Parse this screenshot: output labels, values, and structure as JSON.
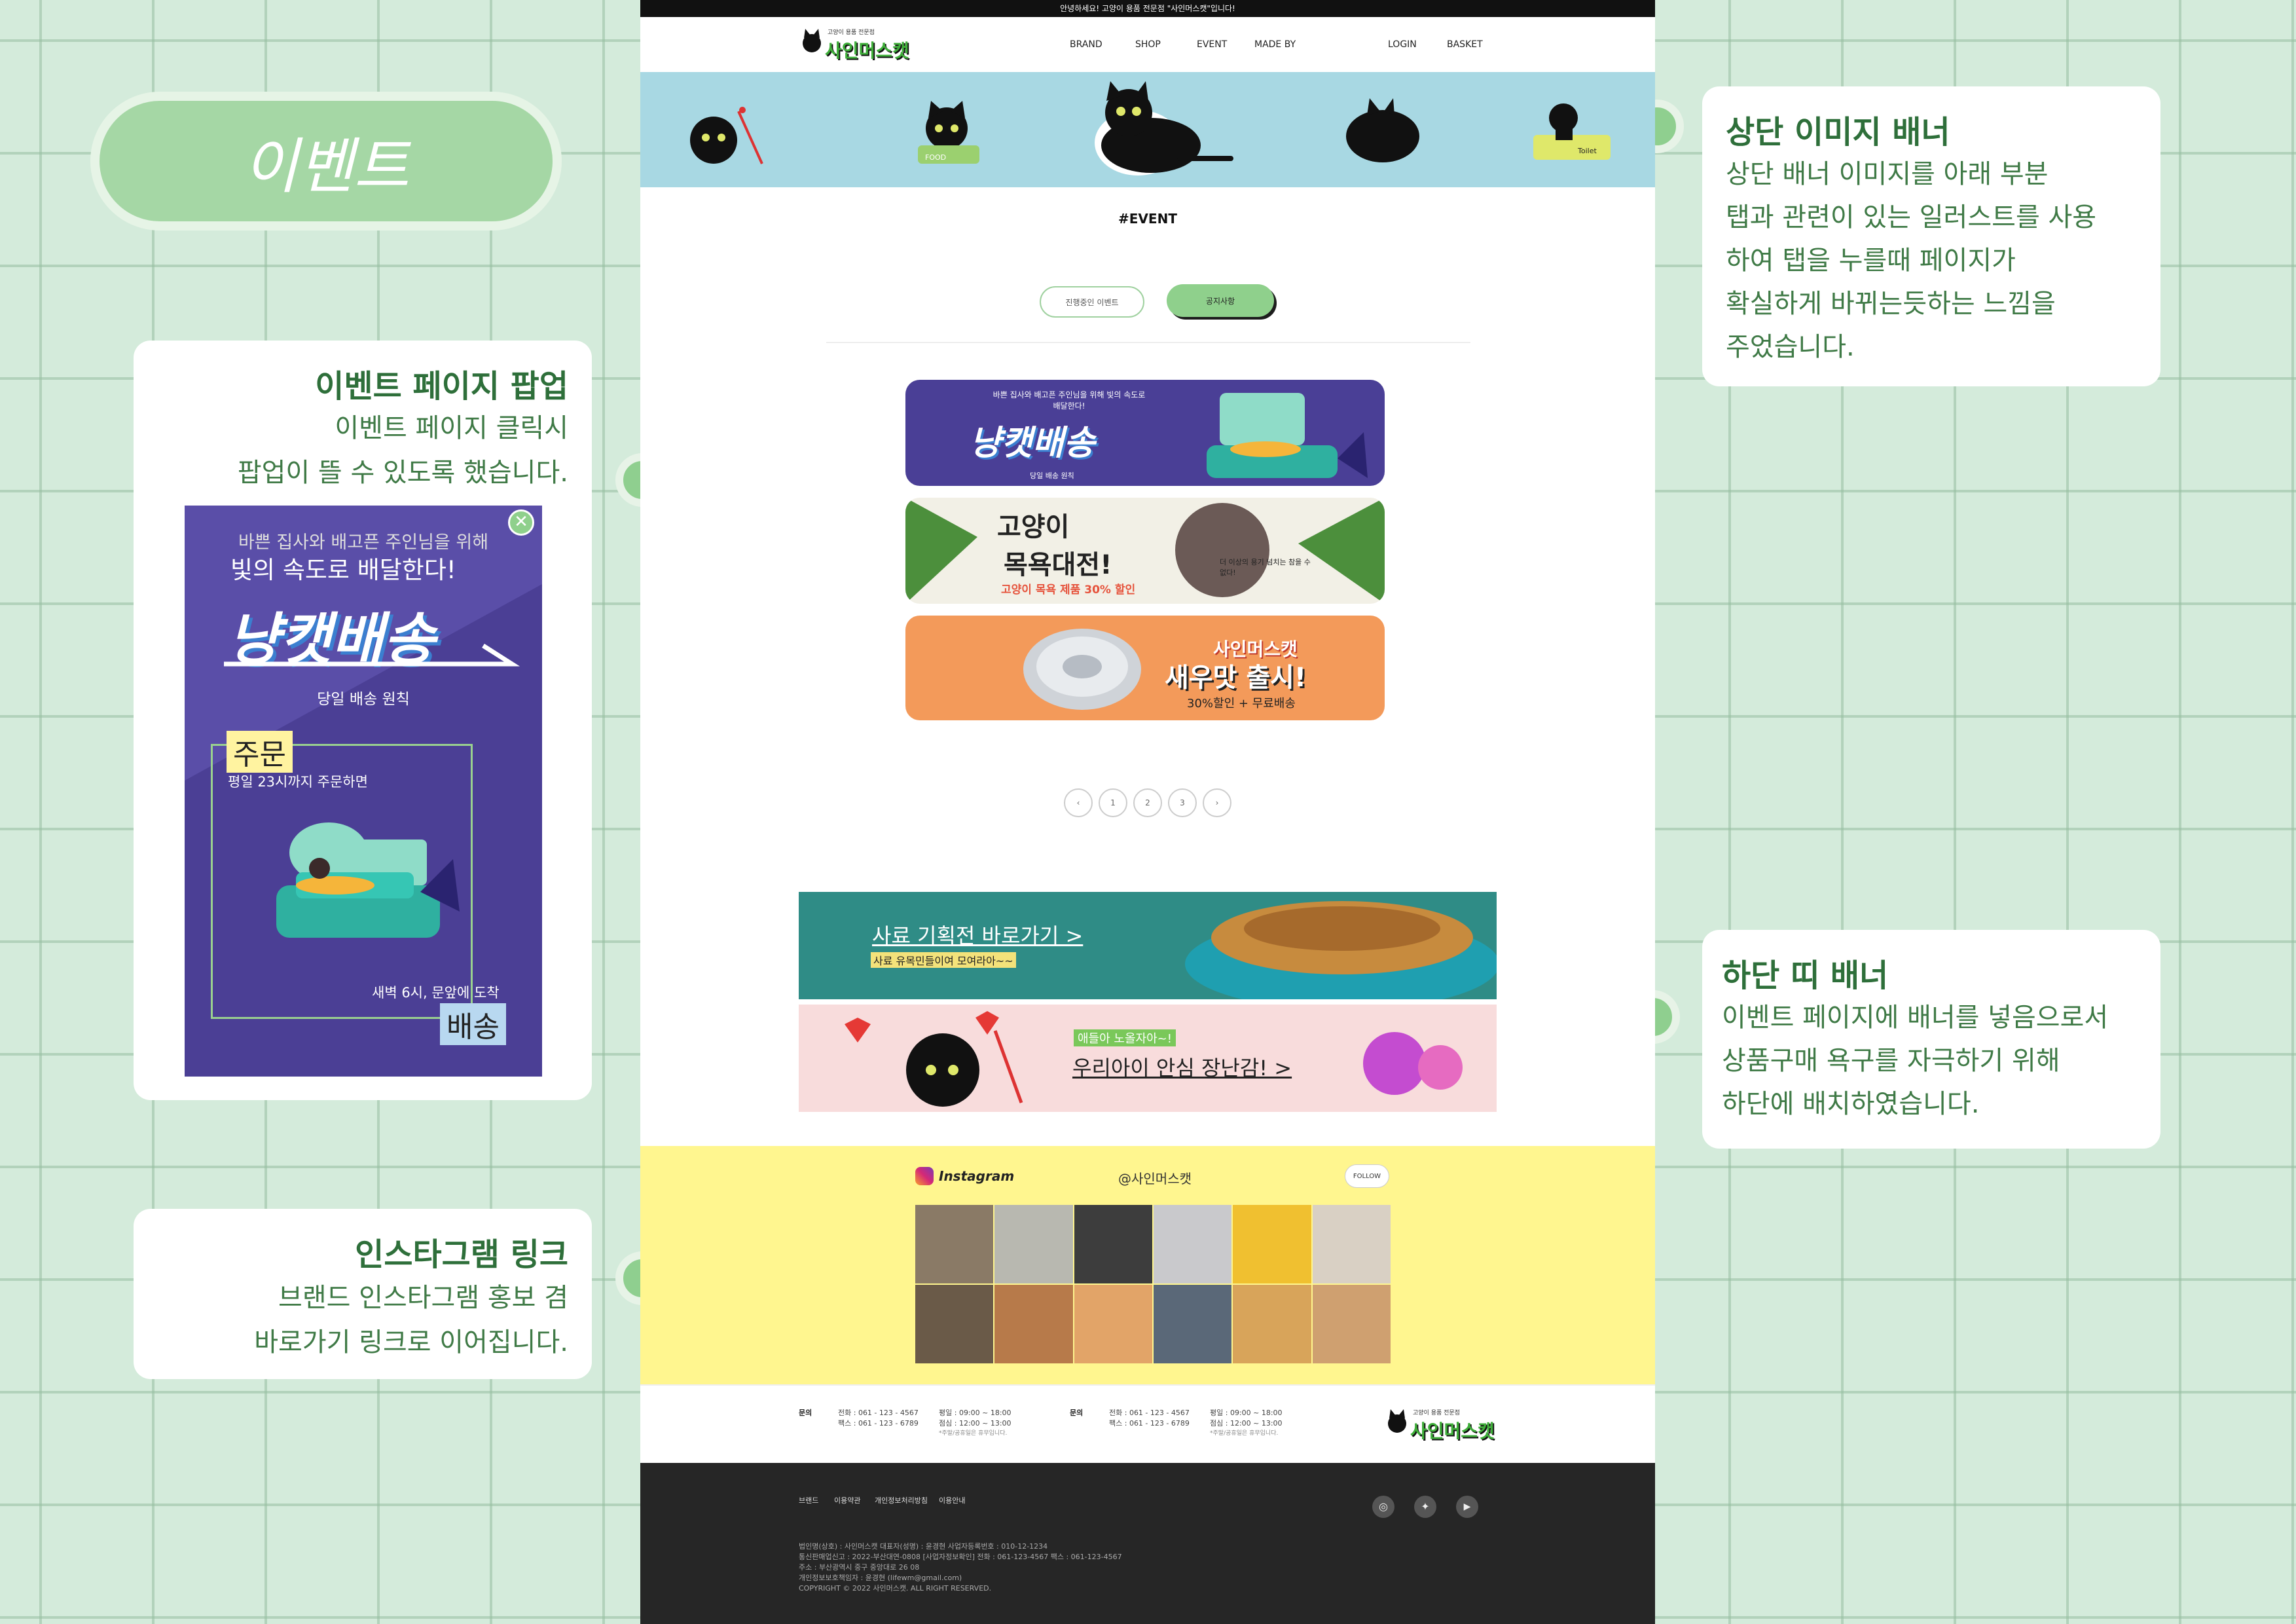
{
  "title": "이벤트",
  "annotations": {
    "popup": {
      "heading": "이벤트 페이지 팝업",
      "lines": [
        "이벤트 페이지 클릭시",
        "팝업이 뜰 수 있도록 했습니다."
      ]
    },
    "instagram": {
      "heading": "인스타그램 링크",
      "lines": [
        "브랜드 인스타그램 홍보 겸",
        "바로가기 링크로 이어집니다."
      ]
    },
    "top_banner": {
      "heading": "상단 이미지 배너",
      "lines": [
        "상단 배너 이미지를 아래 부분",
        "탭과 관련이 있는 일러스트를 사용",
        "하여 탭을 누를때 페이지가",
        "확실하게 바뀌는듯하는 느낌을",
        "주었습니다."
      ]
    },
    "bottom_banner": {
      "heading": "하단 띠 배너",
      "lines": [
        "이벤트 페이지에 배너를 넣음으로서",
        "상품구매 욕구를 자극하기 위해",
        "하단에 배치하였습니다."
      ]
    }
  },
  "popup": {
    "line1": "바쁜 집사와 배고픈 주인님을 위해",
    "line2": "빛의 속도로 배달한다!",
    "title": "냥캣배송",
    "sub": "당일 배송 원칙",
    "order_tag": "주문",
    "order_text": "평일 23시까지 주문하면",
    "deliver_text": "새벽 6시, 문앞에 도착",
    "deliver_tag": "배송"
  },
  "site": {
    "topbar": "안녕하세요! 고양이 용품 전문점 \"사인머스캣\"입니다!",
    "logo_small": "고양이 용품 전문점",
    "logo": "사인머스캣",
    "nav": [
      "BRAND",
      "SHOP",
      "EVENT",
      "MADE BY"
    ],
    "nav_right": [
      "LOGIN",
      "BASKET"
    ],
    "hero_labels": {
      "food": "FOOD",
      "toilet": "Toilet"
    },
    "section_title": "#EVENT",
    "tabs": [
      "진행중인 이벤트",
      "공지사항"
    ],
    "banners": [
      {
        "top": "바쁜 집사와 배고픈 주인님을 위해 빛의 속도로 배달한다!",
        "title": "냥캣배송",
        "sub": "당일 배송 원칙"
      },
      {
        "title1": "고양이",
        "title2": "목욕대전!",
        "sub": "고양이 목욕 제품 30% 할인",
        "side": "더 이상의 용기 넘치는 참을 수 없다!"
      },
      {
        "brand": "사인머스캣",
        "title": "새우맛 출시!",
        "sub": "30%할인 + 무료배송"
      }
    ],
    "pagination": [
      "‹",
      "1",
      "2",
      "3",
      "›"
    ],
    "strips": [
      {
        "title": "사료 기획전 바로가기 >",
        "sub": "사료 유목민들이여 모여라아~~"
      },
      {
        "tag": "애들아 노올자아~!",
        "title": "우리아이 안심 장난감! >"
      }
    ],
    "instagram": {
      "label": "Instagram",
      "handle": "@사인머스캣",
      "follow": "FOLLOW"
    },
    "contact": [
      {
        "label": "문의",
        "phone": "전화 : 061 - 123 - 4567",
        "fax": "팩스 : 061 - 123 - 6789",
        "hours": "평일 : 09:00 ~ 18:00",
        "lunch": "점심 : 12:00 ~ 13:00",
        "note": "*주말/공휴일은 휴무입니다."
      },
      {
        "label": "문의",
        "phone": "전화 : 061 - 123 - 4567",
        "fax": "팩스 : 061 - 123 - 6789",
        "hours": "평일 : 09:00 ~ 18:00",
        "lunch": "점심 : 12:00 ~ 13:00",
        "note": "*주말/공휴일은 휴무입니다."
      }
    ],
    "footer_links": [
      "브랜드",
      "이용약관",
      "개인정보처리방침",
      "이용안내"
    ],
    "company": [
      "법인명(상호) : 사인머스캣 대표자(성명) : 윤경현 사업자등록번호 : 010-12-1234",
      "통신판매업신고 : 2022-부산대연-0808 [사업자정보확인] 전화 : 061-123-4567 팩스 : 061-123-4567",
      "주소 : 부산광역시 중구 중앙대로 26 08",
      "개인정보보호책임자 : 윤경현 (lifewm@gmail.com)",
      "COPYRIGHT © 2022 사인머스캣. ALL RIGHT RESERVED."
    ]
  }
}
